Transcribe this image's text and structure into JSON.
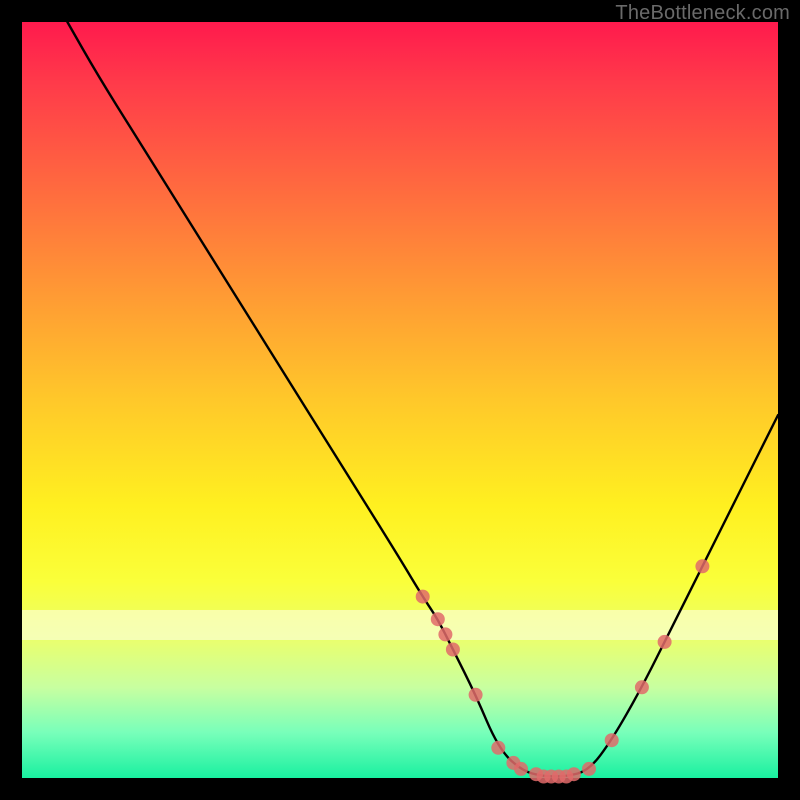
{
  "watermark": "TheBottleneck.com",
  "chart_data": {
    "type": "line",
    "title": "",
    "xlabel": "",
    "ylabel": "",
    "xlim": [
      0,
      100
    ],
    "ylim": [
      0,
      100
    ],
    "grid": false,
    "legend": false,
    "description": "V-shaped bottleneck curve on rainbow gradient background; lower is better (green). Trough near x≈63–75.",
    "series": [
      {
        "name": "bottleneck-curve",
        "x": [
          6,
          10,
          15,
          20,
          25,
          30,
          35,
          40,
          45,
          50,
          53,
          55,
          57,
          60,
          63,
          66,
          69,
          72,
          75,
          78,
          82,
          86,
          90,
          95,
          100
        ],
        "y": [
          100,
          93,
          85,
          77,
          69,
          61,
          53,
          45,
          37,
          29,
          24,
          21,
          17,
          11,
          4,
          1,
          0.2,
          0.2,
          1,
          5,
          12,
          20,
          28,
          38,
          48
        ]
      }
    ],
    "markers": [
      {
        "x": 53,
        "y": 24
      },
      {
        "x": 55,
        "y": 21
      },
      {
        "x": 56,
        "y": 19
      },
      {
        "x": 57,
        "y": 17
      },
      {
        "x": 60,
        "y": 11
      },
      {
        "x": 63,
        "y": 4
      },
      {
        "x": 65,
        "y": 2
      },
      {
        "x": 66,
        "y": 1.2
      },
      {
        "x": 68,
        "y": 0.5
      },
      {
        "x": 69,
        "y": 0.2
      },
      {
        "x": 70,
        "y": 0.2
      },
      {
        "x": 71,
        "y": 0.2
      },
      {
        "x": 72,
        "y": 0.2
      },
      {
        "x": 73,
        "y": 0.5
      },
      {
        "x": 75,
        "y": 1.2
      },
      {
        "x": 78,
        "y": 5
      },
      {
        "x": 82,
        "y": 12
      },
      {
        "x": 85,
        "y": 18
      },
      {
        "x": 90,
        "y": 28
      }
    ],
    "marker_color": "#e06a6a",
    "curve_color": "#000000"
  }
}
